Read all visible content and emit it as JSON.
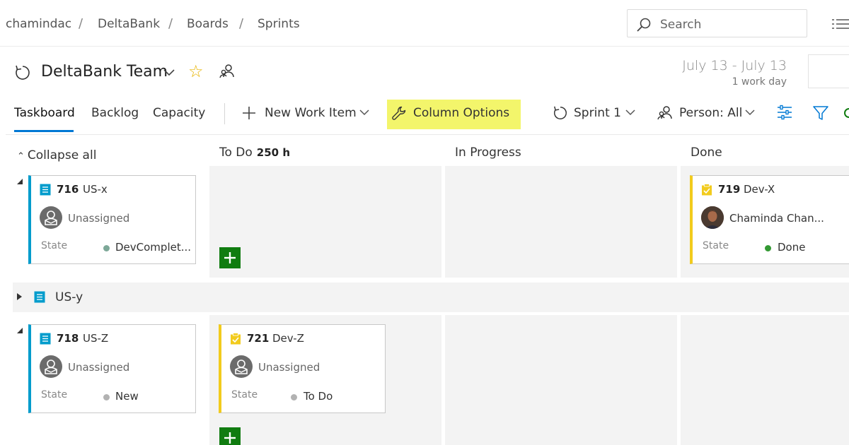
{
  "breadcrumb": {
    "items": [
      "chamindac",
      "DeltaBank",
      "Boards",
      "Sprints"
    ],
    "separator": "/"
  },
  "search": {
    "placeholder": "Search"
  },
  "header": {
    "team_name": "DeltaBank Team",
    "date_range": "July 13 - July 13",
    "work_days": "1 work day"
  },
  "tabs": [
    {
      "label": "Taskboard",
      "active": true
    },
    {
      "label": "Backlog",
      "active": false
    },
    {
      "label": "Capacity",
      "active": false
    }
  ],
  "toolbar": {
    "new_work_item": "New Work Item",
    "column_options": "Column Options",
    "sprint": "Sprint 1",
    "person_filter": "Person: All",
    "highlight_color": "#f3f56b"
  },
  "board": {
    "collapse_all": "Collapse all",
    "columns": [
      {
        "name": "To Do",
        "hours": "250 h"
      },
      {
        "name": "In Progress"
      },
      {
        "name": "Done"
      }
    ],
    "rows": [
      {
        "story": {
          "id": "716",
          "title": "US-x",
          "assignee": "Unassigned",
          "state_label": "State",
          "state": "DevComplet...",
          "state_color": "#7da898"
        },
        "tasks": {
          "done": [
            {
              "id": "719",
              "title": "Dev-X",
              "assignee": "Chaminda Chan...",
              "state_label": "State",
              "state": "Done",
              "state_color": "#339933"
            }
          ]
        }
      },
      {
        "collapsed_story": {
          "title": "US-y"
        }
      },
      {
        "story": {
          "id": "718",
          "title": "US-Z",
          "assignee": "Unassigned",
          "state_label": "State",
          "state": "New",
          "state_color": "#b2b2b2"
        },
        "tasks": {
          "todo": [
            {
              "id": "721",
              "title": "Dev-Z",
              "assignee": "Unassigned",
              "state_label": "State",
              "state": "To Do",
              "state_color": "#b2b2b2"
            }
          ]
        }
      }
    ]
  },
  "colors": {
    "accent": "#0078d4",
    "story_bar": "#009ccc",
    "task_bar": "#f2cb1d",
    "add_button": "#107c10",
    "cell_bg": "#f3f3f3"
  },
  "icons": [
    "sprint-cycle-icon",
    "chevron-down-icon",
    "star-icon",
    "team-members-icon",
    "search-icon",
    "list-icon",
    "plus-icon",
    "wrench-icon",
    "person-filter-icon",
    "settings-sliders-icon",
    "filter-funnel-icon",
    "user-story-icon",
    "task-icon"
  ]
}
